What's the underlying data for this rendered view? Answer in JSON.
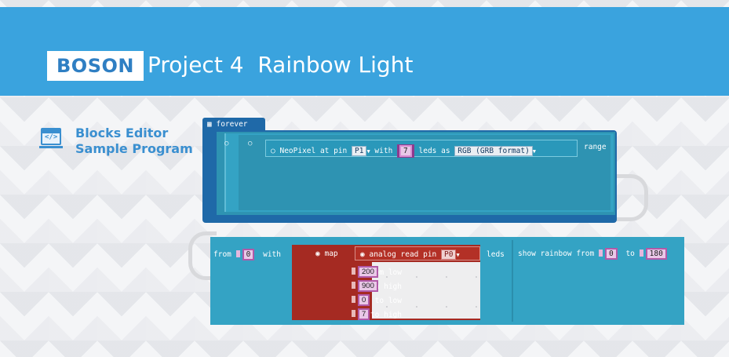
{
  "header": {
    "brand": "BOSON",
    "title": "Project 4  Rainbow Light",
    "background": "#3aa3de"
  },
  "sidebar": {
    "icon": "code-window-icon",
    "icon_glyph": "</>",
    "line1": "Blocks Editor",
    "line2": "Sample Program"
  },
  "blocks": {
    "forever": {
      "glyph": "▦",
      "label": "forever"
    },
    "neopixel": {
      "label_prefix": "NeoPixel at pin",
      "pin": "P1",
      "with_label": "with",
      "count": "7",
      "leds_as_label": "leds as",
      "format": "RGB (GRB format)",
      "range_label": "range"
    },
    "range_row": {
      "from_label": "from",
      "from_value": "0",
      "with_label": "with",
      "leds_label": "leds"
    },
    "map": {
      "label": "map",
      "analog_label": "analog read pin",
      "analog_pin": "P0",
      "rows": [
        {
          "label": "from low",
          "value": "200"
        },
        {
          "label": "from high",
          "value": "900"
        },
        {
          "label": "to low",
          "value": "0"
        },
        {
          "label": "to high",
          "value": "7"
        }
      ]
    },
    "rainbow": {
      "label": "show rainbow from",
      "from_value": "0",
      "to_label": "to",
      "to_value": "180"
    }
  },
  "colors": {
    "loop": "#1f69a8",
    "neopixel": "#34a3c4",
    "map": "#a52a22",
    "value_field": "#eac8e8"
  }
}
